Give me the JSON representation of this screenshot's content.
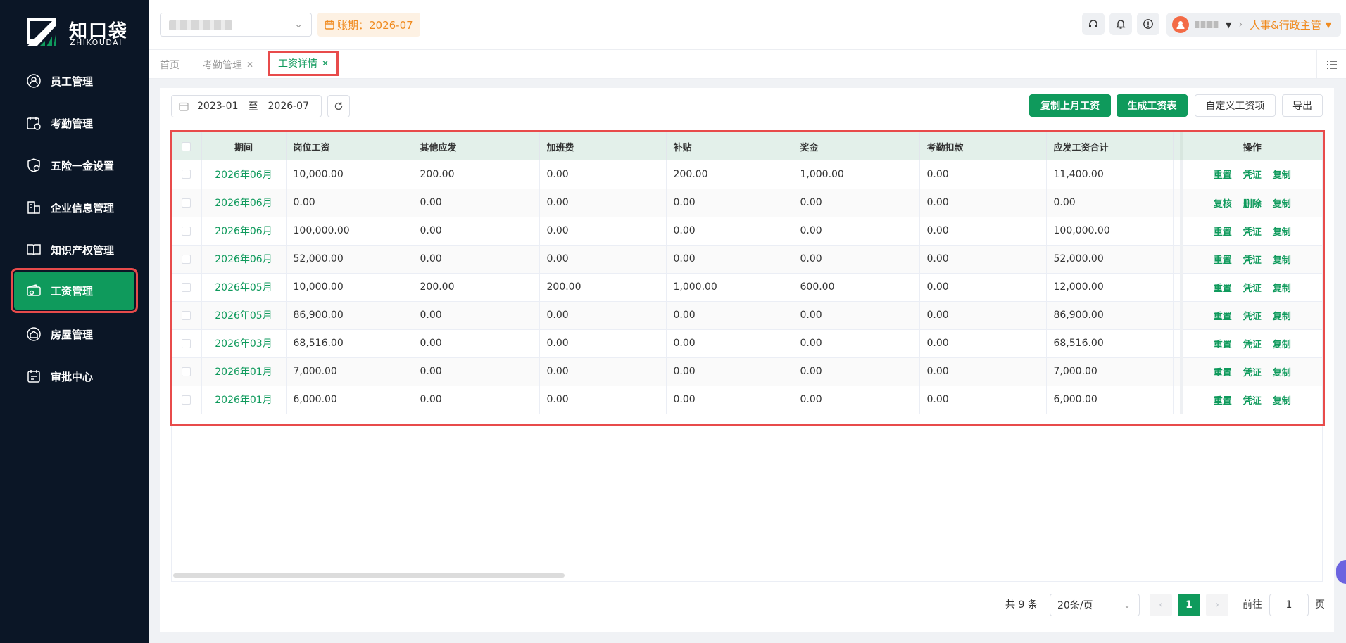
{
  "app": {
    "logo_cn": "知口袋",
    "logo_en": "ZHIKOUDAI"
  },
  "sidebar": {
    "items": [
      {
        "label": "员工管理",
        "icon": "employee-icon",
        "active": false
      },
      {
        "label": "考勤管理",
        "icon": "attendance-icon",
        "active": false
      },
      {
        "label": "五险一金设置",
        "icon": "insurance-icon",
        "active": false
      },
      {
        "label": "企业信息管理",
        "icon": "company-icon",
        "active": false
      },
      {
        "label": "知识产权管理",
        "icon": "book-icon",
        "active": false
      },
      {
        "label": "工资管理",
        "icon": "wallet-icon",
        "active": true
      },
      {
        "label": "房屋管理",
        "icon": "house-icon",
        "active": false
      },
      {
        "label": "审批中心",
        "icon": "approval-icon",
        "active": false
      }
    ]
  },
  "header": {
    "period_label": "账期：2026-07",
    "role": "人事&行政主管"
  },
  "tabs": [
    {
      "label": "首页",
      "closable": false,
      "active": false
    },
    {
      "label": "考勤管理",
      "closable": true,
      "active": false
    },
    {
      "label": "工资详情",
      "closable": true,
      "active": true
    }
  ],
  "toolbar": {
    "date_start": "2023-01",
    "date_sep": "至",
    "date_end": "2026-07",
    "copy_last_month": "复制上月工资",
    "generate_sheet": "生成工资表",
    "custom_items": "自定义工资项",
    "export": "导出"
  },
  "table": {
    "columns": [
      "期间",
      "岗位工资",
      "其他应发",
      "加班费",
      "补贴",
      "奖金",
      "考勤扣款",
      "应发工资合计",
      "操作"
    ],
    "rows": [
      {
        "period": "2026年06月",
        "base": "10,000.00",
        "other": "200.00",
        "overtime": "0.00",
        "allowance": "200.00",
        "bonus": "1,000.00",
        "deduction": "0.00",
        "total": "11,400.00",
        "ops": [
          "重置",
          "凭证",
          "复制"
        ]
      },
      {
        "period": "2026年06月",
        "base": "0.00",
        "other": "0.00",
        "overtime": "0.00",
        "allowance": "0.00",
        "bonus": "0.00",
        "deduction": "0.00",
        "total": "0.00",
        "ops": [
          "复核",
          "删除",
          "复制"
        ]
      },
      {
        "period": "2026年06月",
        "base": "100,000.00",
        "other": "0.00",
        "overtime": "0.00",
        "allowance": "0.00",
        "bonus": "0.00",
        "deduction": "0.00",
        "total": "100,000.00",
        "ops": [
          "重置",
          "凭证",
          "复制"
        ]
      },
      {
        "period": "2026年06月",
        "base": "52,000.00",
        "other": "0.00",
        "overtime": "0.00",
        "allowance": "0.00",
        "bonus": "0.00",
        "deduction": "0.00",
        "total": "52,000.00",
        "ops": [
          "重置",
          "凭证",
          "复制"
        ]
      },
      {
        "period": "2026年05月",
        "base": "10,000.00",
        "other": "200.00",
        "overtime": "200.00",
        "allowance": "1,000.00",
        "bonus": "600.00",
        "deduction": "0.00",
        "total": "12,000.00",
        "ops": [
          "重置",
          "凭证",
          "复制"
        ]
      },
      {
        "period": "2026年05月",
        "base": "86,900.00",
        "other": "0.00",
        "overtime": "0.00",
        "allowance": "0.00",
        "bonus": "0.00",
        "deduction": "0.00",
        "total": "86,900.00",
        "ops": [
          "重置",
          "凭证",
          "复制"
        ]
      },
      {
        "period": "2026年03月",
        "base": "68,516.00",
        "other": "0.00",
        "overtime": "0.00",
        "allowance": "0.00",
        "bonus": "0.00",
        "deduction": "0.00",
        "total": "68,516.00",
        "ops": [
          "重置",
          "凭证",
          "复制"
        ]
      },
      {
        "period": "2026年01月",
        "base": "7,000.00",
        "other": "0.00",
        "overtime": "0.00",
        "allowance": "0.00",
        "bonus": "0.00",
        "deduction": "0.00",
        "total": "7,000.00",
        "ops": [
          "重置",
          "凭证",
          "复制"
        ]
      },
      {
        "period": "2026年01月",
        "base": "6,000.00",
        "other": "0.00",
        "overtime": "0.00",
        "allowance": "0.00",
        "bonus": "0.00",
        "deduction": "0.00",
        "total": "6,000.00",
        "ops": [
          "重置",
          "凭证",
          "复制"
        ]
      }
    ]
  },
  "pagination": {
    "total_text": "共 9 条",
    "page_size": "20条/页",
    "current_page": "1",
    "goto_label": "前往",
    "goto_value": "1",
    "page_suffix": "页"
  },
  "colors": {
    "primary": "#0f9a5c",
    "sidebar_bg": "#0b1626",
    "highlight_outline": "#e84b4b",
    "warning": "#f08a1d"
  }
}
